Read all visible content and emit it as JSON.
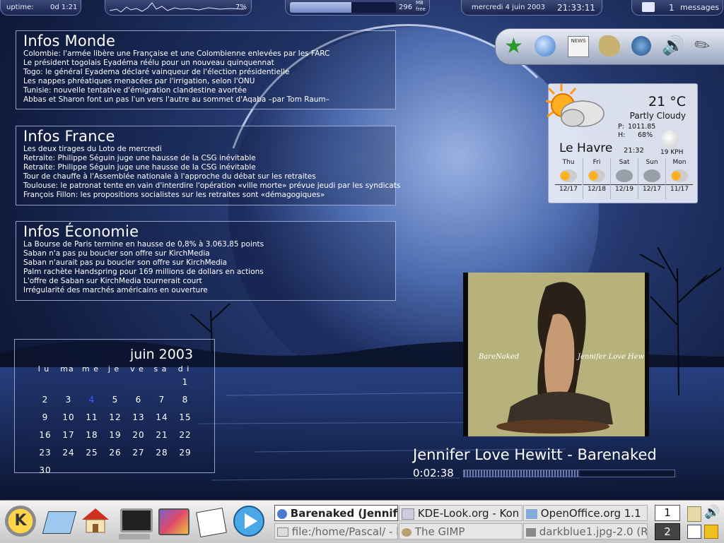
{
  "topbar": {
    "uptime_label": "uptime:",
    "uptime_value": "0d 1:21",
    "cpu_percent": "7%",
    "mem_value": "296",
    "mem_unit_top": "MB",
    "mem_unit_bottom": "free",
    "date": "mercredi 4 juin 2003",
    "time": "21:33:11",
    "messages_count": "1",
    "messages_label": "messages"
  },
  "quicklaunch": [
    "star-app-icon",
    "globe-icon",
    "news-icon",
    "gimp-icon",
    "hat-icon",
    "speaker-icon",
    "feather-icon"
  ],
  "news": [
    {
      "title": "Infos Monde",
      "lines": [
        "Colombie: l'armée libère une Française et une Colombienne enlevées par les FARC",
        "Le président togolais Eyadéma réélu pour un nouveau quinquennat",
        "Togo: le général Eyadema déclaré vainqueur de l'élection présidentielle",
        "Les nappes phréatiques menacées par l'irrigation, selon l'ONU",
        "Tunisie: nouvelle tentative d'émigration clandestine avortée",
        "Abbas et Sharon font un pas l'un vers l'autre au sommet d'Aqaba –par Tom Raum–"
      ]
    },
    {
      "title": "Infos France",
      "lines": [
        "Les deux tirages du Loto de mercredi",
        "Retraite: Philippe Séguin juge une hausse de la CSG inévitable",
        "Retraite: Philippe Séguin juge une hausse de la CSG inévitable",
        "Tour de chauffe à l'Assemblée nationale à l'approche du débat sur les retraites",
        "Toulouse: le patronat tente en vain d'interdire l'opération «ville morte» prévue jeudi par les syndicats",
        "François Fillon: les propositions socialistes sur les retraites sont «démagogiques»"
      ]
    },
    {
      "title": "Infos Économie",
      "lines": [
        "La Bourse de Paris termine en hausse de 0,8% à 3.063,85 points",
        "Saban n'a pas pu boucler son offre sur KirchMedia",
        "Saban n'aurait pas pu boucler son offre sur KirchMedia",
        "Palm rachète Handspring pour 169 millions de dollars en actions",
        "L'offre de Saban sur KirchMedia tournerait court",
        "Irrégularité des marchés américains en ouverture"
      ]
    }
  ],
  "weather": {
    "temp": "21 °C",
    "condition": "Partly Cloudy",
    "pressure_label": "P:",
    "pressure": "1011.85",
    "humidity_label": "H:",
    "humidity": "68%",
    "city": "Le Havre",
    "time": "21:32",
    "wind": "19 KPH",
    "forecast": [
      {
        "day": "Thu",
        "temps": "12/17",
        "icon": "sun-cloud-icon"
      },
      {
        "day": "Fri",
        "temps": "12/18",
        "icon": "sun-cloud-icon"
      },
      {
        "day": "Sat",
        "temps": "12/19",
        "icon": "rain-cloud-icon"
      },
      {
        "day": "Sun",
        "temps": "12/17",
        "icon": "rain-cloud-icon"
      },
      {
        "day": "Mon",
        "temps": "11/17",
        "icon": "sun-cloud-icon"
      }
    ]
  },
  "calendar": {
    "title": "juin 2003",
    "weekdays": [
      "l u",
      "ma",
      "m e",
      "j e",
      "v e",
      "s a",
      "d i"
    ],
    "today": "4",
    "weeks": [
      [
        "",
        "",
        "",
        "",
        "",
        "",
        "1"
      ],
      [
        "2",
        "3",
        "4",
        "5",
        "6",
        "7",
        "8"
      ],
      [
        "9",
        "10",
        "11",
        "12",
        "13",
        "14",
        "15"
      ],
      [
        "16",
        "17",
        "18",
        "19",
        "20",
        "21",
        "22"
      ],
      [
        "23",
        "24",
        "25",
        "26",
        "27",
        "28",
        "29"
      ],
      [
        "30",
        "",
        "",
        "",
        "",
        "",
        ""
      ]
    ]
  },
  "player": {
    "track": "Jennifer Love Hewitt - Barenaked",
    "elapsed": "0:02:38",
    "progress": 0.55,
    "cover_text_left": "BareNaked",
    "cover_text_right": "Jennifer Love Hewitt"
  },
  "taskbar": {
    "launchers": [
      "kde-menu-icon",
      "kwrite-icon",
      "home-icon",
      "terminal-icon",
      "konsole-tools-icon",
      "notes-icon",
      "media-play-icon"
    ],
    "tasks": [
      {
        "label": "Barenaked (Jennifer",
        "icon": "xmms-icon",
        "active": true
      },
      {
        "label": "KDE-Look.org - Kon",
        "icon": "kde-look-icon",
        "active": false
      },
      {
        "label": "OpenOffice.org 1.1",
        "icon": "openoffice-icon",
        "active": false
      },
      {
        "label": "file:/home/Pascal/ - k",
        "icon": "folder-icon",
        "active": false
      },
      {
        "label": "The GIMP",
        "icon": "gimp-icon",
        "active": false
      },
      {
        "label": "darkblue1.jpg-2.0 (R",
        "icon": "image-icon",
        "active": false
      }
    ],
    "desktops": [
      "1",
      "2"
    ],
    "current_desktop": "2"
  },
  "colors": {
    "panel_border": "#bec8eb",
    "calendar_today": "#3a5cff",
    "weather_bg": "#e8ecf6"
  }
}
